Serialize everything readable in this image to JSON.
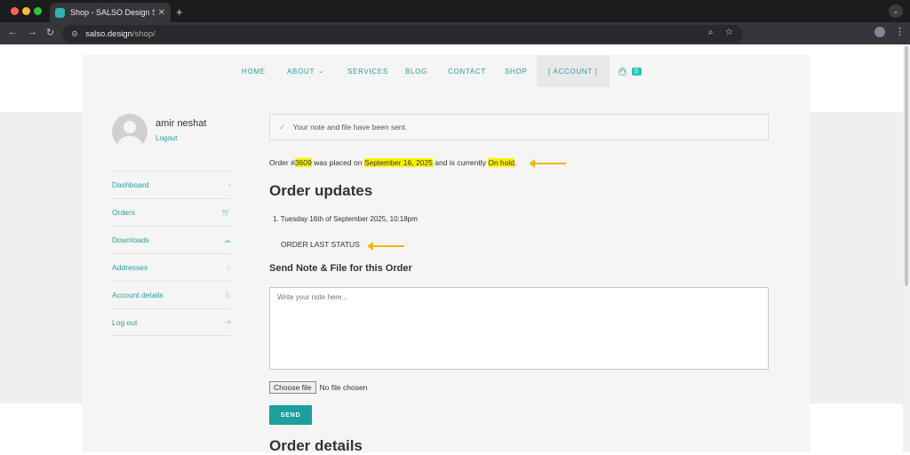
{
  "browser": {
    "tab_title": "Shop - SALSO Design Studio",
    "tab_close": "✕",
    "new_tab": "+",
    "url_host": "salso.design",
    "url_path": "/shop/"
  },
  "nav": {
    "items": [
      "HOME",
      "ABOUT",
      "SERVICES",
      "BLOG",
      "CONTACT",
      "SHOP",
      "[ ACCOUNT ]"
    ],
    "cart_count": "0"
  },
  "user": {
    "name": "amir neshat",
    "logout": "Logout"
  },
  "sidebar": {
    "items": [
      {
        "label": "Dashboard",
        "icon": "gauge-icon"
      },
      {
        "label": "Orders",
        "icon": "cart-icon"
      },
      {
        "label": "Downloads",
        "icon": "download-cloud-icon"
      },
      {
        "label": "Addresses",
        "icon": "home-icon"
      },
      {
        "label": "Account details",
        "icon": "user-icon"
      },
      {
        "label": "Log out",
        "icon": "logout-icon"
      }
    ]
  },
  "notice": "Your note and file have been sent.",
  "order": {
    "prefix": "Order #",
    "number": "3609",
    "placed_text": " was placed on ",
    "date": "September 16, 2025",
    "status_text": " and is currently ",
    "status": "On hold",
    "suffix": "."
  },
  "updates": {
    "heading": "Order updates",
    "item": "1. Tuesday 16th of September 2025, 10:18pm",
    "last_status": "ORDER LAST STATUS"
  },
  "send_form": {
    "heading": "Send Note & File for this Order",
    "placeholder": "Write your note here...",
    "choose_file": "Choose file",
    "no_file": "No file chosen",
    "send": "SEND"
  },
  "details_heading": "Order details",
  "colors": {
    "accent": "#2a9d9a",
    "highlight": "#fff200",
    "arrow": "#f3b61b"
  }
}
